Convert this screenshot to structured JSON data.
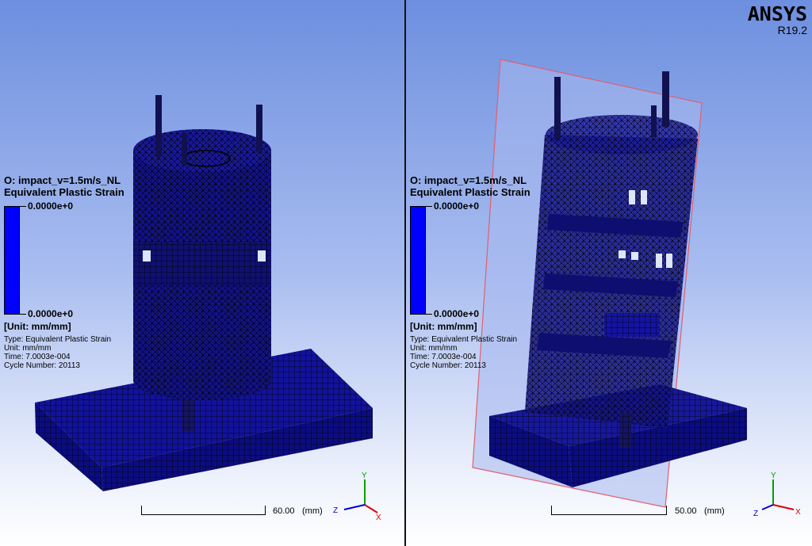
{
  "viewports": [
    {
      "result_name": "O: impact_v=1.5m/s_NL",
      "result_type": "Equivalent Plastic Strain",
      "legend_max": "0.0000e+0",
      "legend_min": "0.0000e+0",
      "unit_label": "[Unit: mm/mm]",
      "info_type": "Type: Equivalent Plastic Strain",
      "info_unit": "Unit: mm/mm",
      "info_time": "Time: 7.0003e-004",
      "info_cycle": "Cycle Number: 20113",
      "scale_label": "60.00",
      "scale_unit": "(mm)",
      "axis_y": "Y",
      "axis_z": "Z",
      "axis_x": "X"
    },
    {
      "result_name": "O: impact_v=1.5m/s_NL",
      "result_type": "Equivalent Plastic Strain",
      "legend_max": "0.0000e+0",
      "legend_min": "0.0000e+0",
      "unit_label": "[Unit: mm/mm]",
      "info_type": "Type: Equivalent Plastic Strain",
      "info_unit": "Unit: mm/mm",
      "info_time": "Time: 7.0003e-004",
      "info_cycle": "Cycle Number: 20113",
      "scale_label": "50.00",
      "scale_unit": "(mm)",
      "axis_y": "Y",
      "axis_z": "Z",
      "axis_x": "X"
    }
  ],
  "brand": {
    "logo": "ANSYS",
    "version": "R19.2"
  },
  "colors": {
    "mesh_fill": "#10108c",
    "legend_color": "#0000ff",
    "section_plane": "#e06070",
    "axis_x": "#e00000",
    "axis_y": "#00a000",
    "axis_z": "#0000e0"
  },
  "icons": [
    "section-plane",
    "coordinate-triad"
  ]
}
